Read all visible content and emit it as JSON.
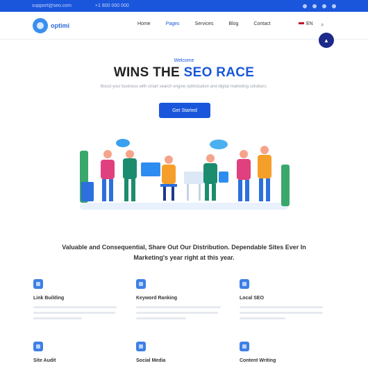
{
  "topbar": {
    "items": [
      "support@seo.com",
      "+1 800 000 000"
    ],
    "social": [
      "facebook-icon",
      "twitter-icon",
      "linkedin-icon",
      "instagram-icon"
    ]
  },
  "brand": {
    "name": "optimi"
  },
  "nav": {
    "items": [
      "Home",
      "Pages",
      "Services",
      "Blog",
      "Contact"
    ],
    "active_index": 1,
    "language": "EN"
  },
  "hero": {
    "kicker": "Welcome",
    "title_plain": "WINS THE",
    "title_highlight": "SEO RACE",
    "subtitle": "Boost your business with smart search engine optimization and digital marketing solutions.",
    "cta_label": "Get Started"
  },
  "section": {
    "title": "Valuable and Consequential, Share Out Our Distribution. Dependable Sites Ever In Marketing's year right at this year."
  },
  "features": [
    {
      "icon": "chart-icon",
      "title": "Link Building",
      "desc": ""
    },
    {
      "icon": "tag-icon",
      "title": "Keyword Ranking",
      "desc": ""
    },
    {
      "icon": "user-icon",
      "title": "Local SEO",
      "desc": ""
    },
    {
      "icon": "search-icon",
      "title": "Site Audit",
      "desc": ""
    },
    {
      "icon": "megaphone-icon",
      "title": "Social Media",
      "desc": ""
    },
    {
      "icon": "pen-icon",
      "title": "Content Writing",
      "desc": ""
    }
  ],
  "colors": {
    "primary": "#1a56db",
    "topbar": "#1a56db",
    "fab": "#1c2a8a"
  }
}
